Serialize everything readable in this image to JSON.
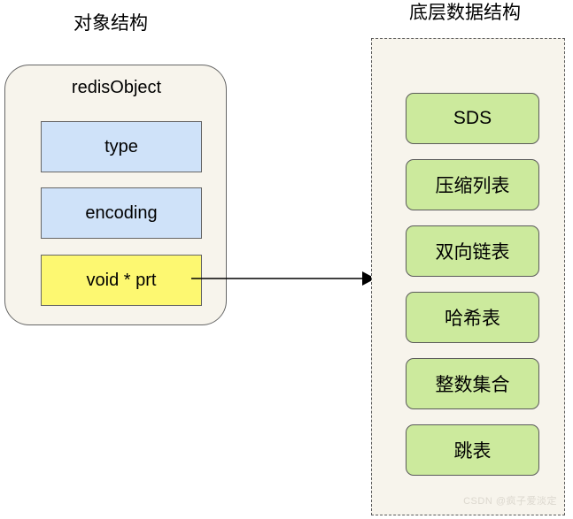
{
  "diagram": {
    "left_panel": {
      "title": "对象结构",
      "card_title": "redisObject",
      "fields": [
        {
          "label": "type",
          "color": "#cfe2f9",
          "kind": "blue"
        },
        {
          "label": "encoding",
          "color": "#cfe2f9",
          "kind": "blue"
        },
        {
          "label": "void * prt",
          "color": "#fdf871",
          "kind": "yellow"
        }
      ]
    },
    "right_panel": {
      "title": "底层数据结构",
      "items": [
        {
          "label": "SDS"
        },
        {
          "label": "压缩列表"
        },
        {
          "label": "双向链表"
        },
        {
          "label": "哈希表"
        },
        {
          "label": "整数集合"
        },
        {
          "label": "跳表"
        }
      ],
      "box_color": "#ccea9d",
      "panel_color": "#f7f4ec"
    },
    "connector": {
      "name": "arrow-pointer-to-structures",
      "from": "void * prt",
      "to": "底层数据结构"
    },
    "watermark": "CSDN @疯子爱淡定",
    "colors": {
      "card_fill": "#f7f4ec",
      "blue_fill": "#cfe2f9",
      "yellow_fill": "#fdf871",
      "green_fill": "#ccea9d",
      "stroke": "#666666",
      "background": "#ffffff"
    }
  }
}
